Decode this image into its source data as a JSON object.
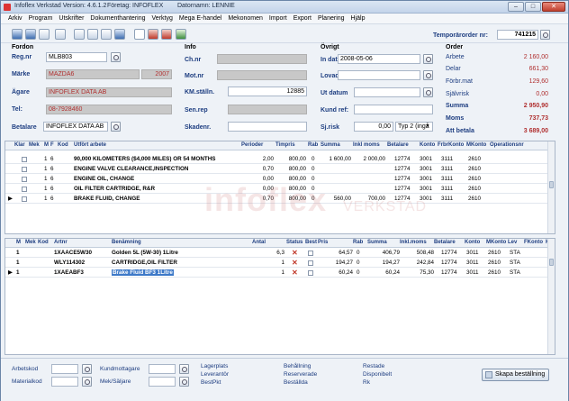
{
  "titlebar": {
    "app": "Infoflex Verkstad Version: 4.6.1.2",
    "company": "Företag: INFOFLEX",
    "user": "Datornamn: LENNIE"
  },
  "menu": [
    "Arkiv",
    "Program",
    "Utskrifter",
    "Dokumenthantering",
    "Verktyg",
    "Mega E-handel",
    "Mekonomen",
    "Import",
    "Export",
    "Planering",
    "Hjälp"
  ],
  "order_no": {
    "label": "Temporärorder nr:",
    "value": "741215"
  },
  "fordon": {
    "title": "Fordon",
    "regnr_label": "Reg.nr",
    "regnr": "MLB803",
    "marke_label": "Märke",
    "marke": "MAZDA6",
    "year": "2007",
    "agare_label": "Ägare",
    "agare": "INFOFLEX DATA AB",
    "tel_label": "Tel:",
    "tel": "08-7928460",
    "betalare_label": "Betalare",
    "betalare": "INFOFLEX DATA AB"
  },
  "info": {
    "title": "Info",
    "chnr_label": "Ch.nr",
    "motnr_label": "Mot.nr",
    "km_label": "KM.ställn.",
    "km": "12885",
    "senrep_label": "Sen.rep",
    "skadenr_label": "Skadenr."
  },
  "ovrigt": {
    "title": "Övrigt",
    "indatum_label": "In datum",
    "indatum": "2008-05-06",
    "lovad_label": "Lovad",
    "utdatum_label": "Ut datum",
    "kundref_label": "Kund ref:",
    "sjrisk_label": "Sj.risk",
    "sjrisk": "0,00",
    "typ": "Typ 2 (ingå"
  },
  "order": {
    "title": "Order",
    "rows": [
      {
        "label": "Arbete",
        "value": "2 160,00"
      },
      {
        "label": "Delar",
        "value": "661,30"
      },
      {
        "label": "Förbr.mat",
        "value": "129,60"
      },
      {
        "label": "Självrisk",
        "value": "0,00"
      },
      {
        "label": "Summa",
        "value": "2 950,90",
        "bold": true
      },
      {
        "label": "Moms",
        "value": "737,73",
        "bold": true
      },
      {
        "label": "Att betala",
        "value": "3 689,00",
        "bold": true
      }
    ]
  },
  "work_grid": {
    "headers": [
      "Klar",
      "Mek",
      "M",
      "F",
      "Kod",
      "Utfört arbete",
      "Perioder",
      "Timpris",
      "Rab",
      "Summa",
      "Inkl moms",
      "Betalare",
      "Konto",
      "FrbrKonto",
      "MKonto",
      "Operationsnr"
    ],
    "rows": [
      {
        "m": "1",
        "f": "6",
        "text": "90,000 KILOMETERS ($4,000 MILES) OR 54 MONTHS",
        "per": "2,00",
        "tim": "800,00",
        "rab": "0",
        "sum": "1 600,00",
        "inkl": "2 000,00",
        "bet": "12774",
        "konto": "3001",
        "frbr": "3111",
        "mk": "2610"
      },
      {
        "m": "1",
        "f": "6",
        "text": "ENGINE VALVE CLEARANCE,INSPECTION",
        "per": "0,70",
        "tim": "800,00",
        "rab": "0",
        "sum": "",
        "inkl": "",
        "bet": "12774",
        "konto": "3001",
        "frbr": "3111",
        "mk": "2610"
      },
      {
        "m": "1",
        "f": "6",
        "text": "ENGINE OIL, CHANGE",
        "per": "0,00",
        "tim": "800,00",
        "rab": "0",
        "sum": "",
        "inkl": "",
        "bet": "12774",
        "konto": "3001",
        "frbr": "3111",
        "mk": "2610"
      },
      {
        "m": "1",
        "f": "6",
        "text": "OIL FILTER CARTRIDGE, R&R",
        "per": "0,00",
        "tim": "800,00",
        "rab": "0",
        "sum": "",
        "inkl": "",
        "bet": "12774",
        "konto": "3001",
        "frbr": "3111",
        "mk": "2610"
      },
      {
        "m": "1",
        "f": "6",
        "text": "BRAKE FLUID, CHANGE",
        "per": "0,70",
        "tim": "800,00",
        "rab": "0",
        "sum": "560,00",
        "inkl": "700,00",
        "bet": "12774",
        "konto": "3001",
        "frbr": "3111",
        "mk": "2610"
      }
    ]
  },
  "parts_grid": {
    "headers": [
      "M",
      "Mek",
      "Kod",
      "Artnr",
      "Benämning",
      "Antal",
      "Status",
      "Best",
      "Pris",
      "Rab",
      "Summa",
      "Inkl.moms",
      "Betalare",
      "Konto",
      "MKonto",
      "Lev",
      "FKonto",
      "K"
    ],
    "rows": [
      {
        "m": "1",
        "artnr": "1XAACE5W30",
        "ben": "Golden 5L (5W-30) 1Litre",
        "antal": "6,3",
        "pris": "64,57",
        "rab": "0",
        "sum": "406,79",
        "inkl": "508,48",
        "bet": "12774",
        "konto": "3011",
        "mk": "2610",
        "lev": "STA"
      },
      {
        "m": "1",
        "artnr": "WLY114302",
        "ben": "CARTRIDGE,OIL FILTER",
        "antal": "1",
        "pris": "194,27",
        "rab": "0",
        "sum": "194,27",
        "inkl": "242,84",
        "bet": "12774",
        "konto": "3011",
        "mk": "2610",
        "lev": "STA"
      },
      {
        "m": "1",
        "artnr": "1XAEABF3",
        "ben": "Brake Fluid BF3 1Litre",
        "antal": "1",
        "pris": "60,24",
        "rab": "0",
        "sum": "60,24",
        "inkl": "75,30",
        "bet": "12774",
        "konto": "3011",
        "mk": "2610",
        "lev": "STA"
      }
    ]
  },
  "watermark": {
    "brand": "infoflex",
    "sub": "VERKSTAD"
  },
  "bottom": {
    "arbetskod": "Arbetskod",
    "materialkod": "Materialkod",
    "kundmottagare": "Kundmottagare",
    "mek_saljare": "Mek/Säljare",
    "col1": [
      "Lagerplats",
      "Leverantör",
      "BestPkt"
    ],
    "col2": [
      "Behållning",
      "Reserverade",
      "Beställda"
    ],
    "col3": [
      "Restade",
      "Disponibelt",
      "Rk"
    ],
    "create_order": "Skapa beställning"
  },
  "colors": {
    "label": "#1d3d80",
    "value_red": "#b03030",
    "title_bg": "#c3d4ea"
  }
}
